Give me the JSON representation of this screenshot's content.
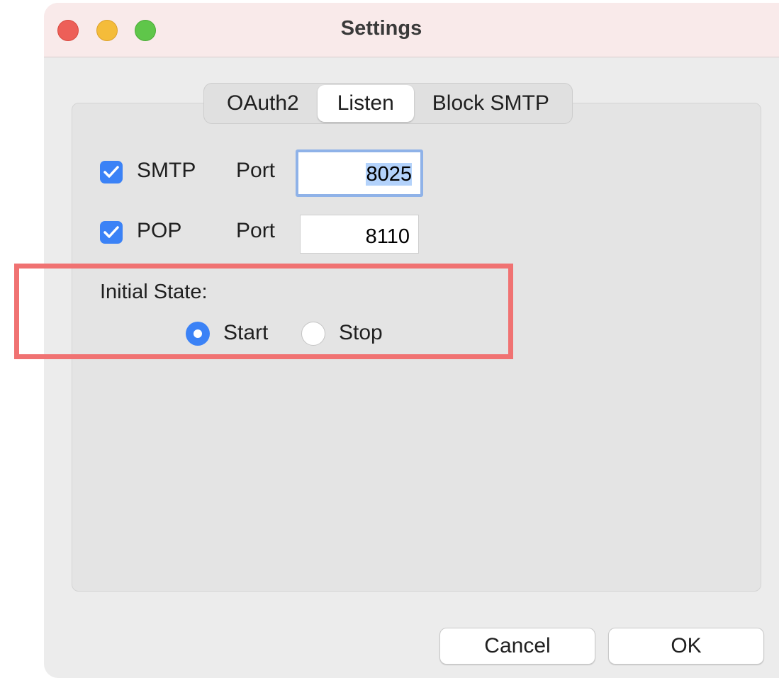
{
  "window": {
    "title": "Settings"
  },
  "tabs": [
    {
      "label": "OAuth2"
    },
    {
      "label": "Listen"
    },
    {
      "label": "Block SMTP"
    }
  ],
  "active_tab": "Listen",
  "smtp": {
    "label": "SMTP",
    "checked": true,
    "port_label": "Port",
    "port_value": "8025"
  },
  "pop": {
    "label": "POP",
    "checked": true,
    "port_label": "Port",
    "port_value": "8110"
  },
  "initial_state": {
    "label": "Initial State:",
    "options": [
      {
        "label": "Start",
        "selected": true
      },
      {
        "label": "Stop",
        "selected": false
      }
    ]
  },
  "buttons": {
    "cancel": "Cancel",
    "ok": "OK"
  },
  "colors": {
    "accent": "#3b82f6",
    "highlight": "#f07272",
    "titlebar": "#f9eaea"
  }
}
